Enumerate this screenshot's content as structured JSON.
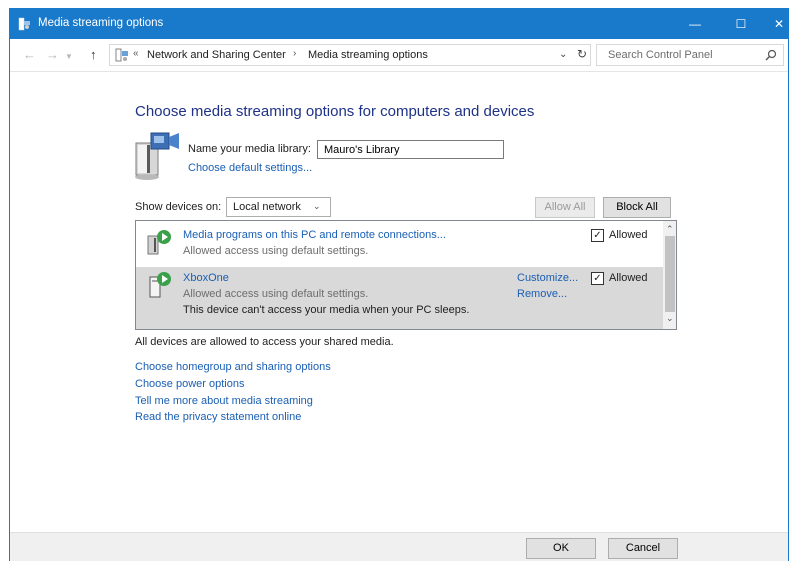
{
  "window": {
    "title": "Media streaming options",
    "controls": {
      "minimize": "—",
      "maximize": "☐",
      "close": "✕"
    },
    "accent_color": "#1979ca"
  },
  "nav": {
    "back_icon": "arrow-left-icon",
    "forward_icon": "arrow-right-icon",
    "up_icon": "arrow-up-icon",
    "breadcrumb": [
      "Network and Sharing Center",
      "Media streaming options"
    ],
    "overflow_chevron": "«",
    "separator": "›",
    "search_placeholder": "Search Control Panel"
  },
  "main": {
    "heading": "Choose media streaming options for computers and devices",
    "library_label": "Name your media library:",
    "library_name": "Mauro's Library",
    "default_settings_link": "Choose default settings...",
    "show_devices_label": "Show devices on:",
    "show_devices_value": "Local network",
    "allow_all_label": "Allow All",
    "block_all_label": "Block All",
    "devices": [
      {
        "name": "Media programs on this PC and remote connections...",
        "description": "Allowed access using default settings.",
        "allowed": true,
        "allowed_label": "Allowed"
      },
      {
        "name": "XboxOne",
        "description": "Allowed access using default settings.",
        "note": "This device can't access your media when your PC sleeps.",
        "customize_label": "Customize...",
        "remove_label": "Remove...",
        "allowed": true,
        "allowed_label": "Allowed",
        "selected": true
      }
    ],
    "all_devices_status": "All devices are allowed to access your shared media.",
    "links": [
      "Choose homegroup and sharing options",
      "Choose power options",
      "Tell me more about media streaming",
      "Read the privacy statement online"
    ]
  },
  "footer": {
    "ok_label": "OK",
    "cancel_label": "Cancel"
  }
}
